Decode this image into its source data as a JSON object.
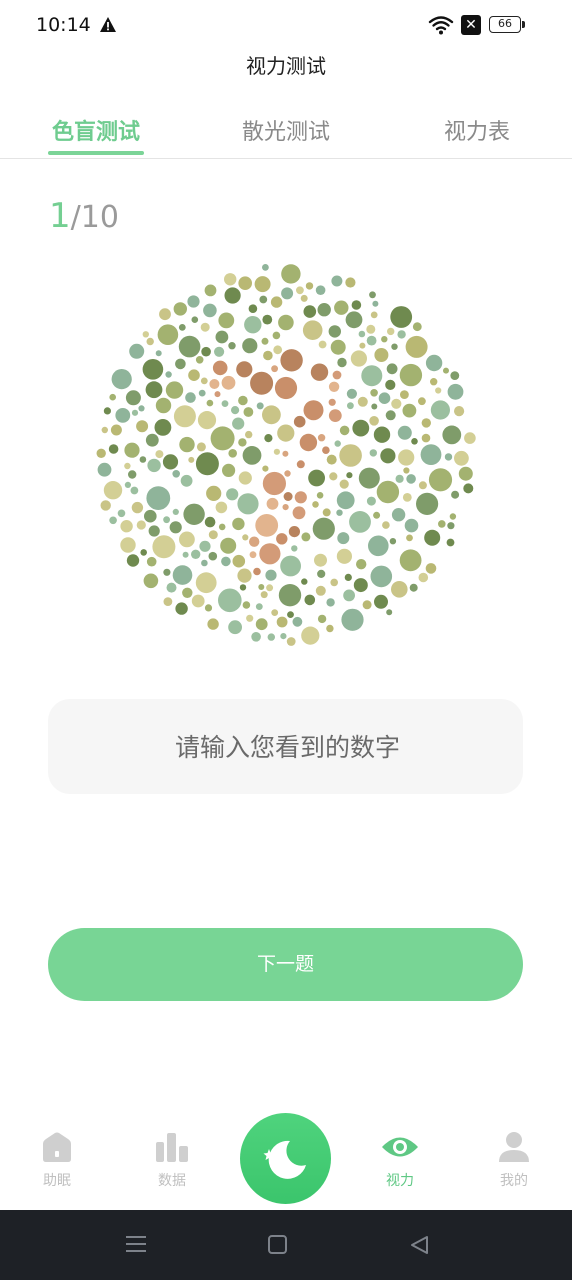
{
  "status_bar": {
    "time": "10:14",
    "battery_level": "66",
    "icons": [
      "warning-icon",
      "wifi-icon",
      "sim-off-icon",
      "battery-icon"
    ]
  },
  "header": {
    "title": "视力测试"
  },
  "tabs": [
    {
      "label": "色盲测试",
      "active": true
    },
    {
      "label": "散光测试",
      "active": false
    },
    {
      "label": "视力表",
      "active": false
    }
  ],
  "progress": {
    "current": "1",
    "total": "/10"
  },
  "answer": {
    "placeholder": "请输入您看到的数字",
    "value": ""
  },
  "next_button": {
    "label": "下一题"
  },
  "bottom_nav": {
    "items": [
      {
        "label": "助眠",
        "icon": "house-icon",
        "active": false
      },
      {
        "label": "数据",
        "icon": "bar-chart-icon",
        "active": false
      },
      {
        "label": "",
        "icon": "moon-star-icon",
        "active": false
      },
      {
        "label": "视力",
        "icon": "eye-icon",
        "active": true
      },
      {
        "label": "我的",
        "icon": "person-icon",
        "active": false
      }
    ]
  },
  "colors": {
    "accent": "#78d595",
    "accent_text": "#6fcc8f",
    "fab": "#3bc56c",
    "inactive": "#c0c0c0",
    "system_bar": "#1e2126"
  }
}
